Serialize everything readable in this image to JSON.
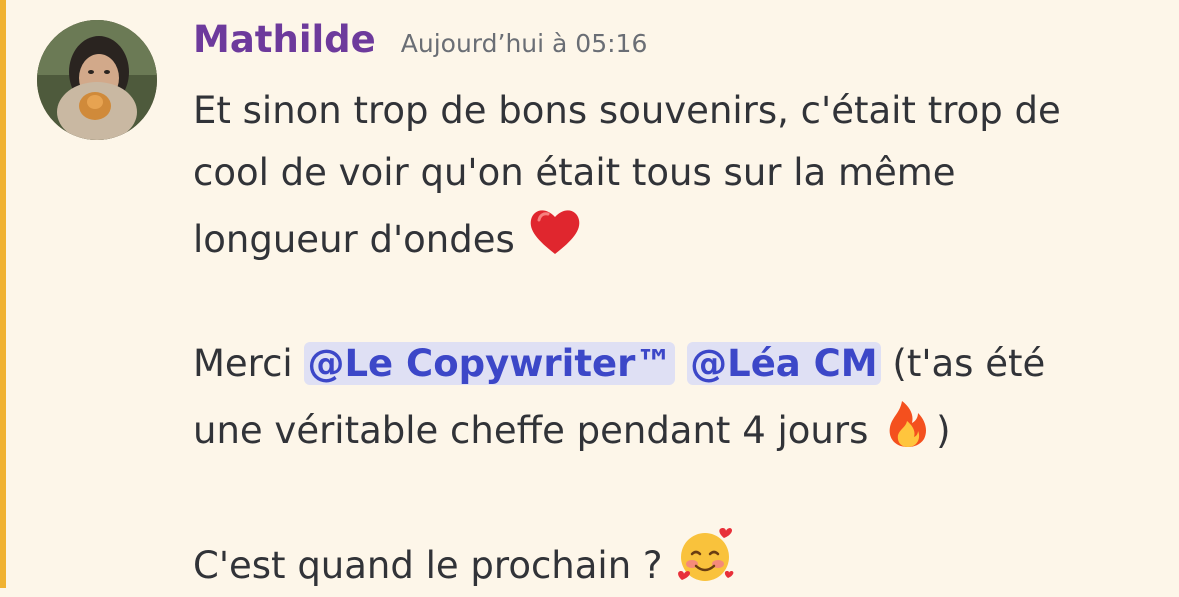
{
  "message": {
    "author": "Mathilde",
    "timestamp": "Aujourd’hui à 05:16",
    "author_color": "#6d3a9c",
    "accent_color": "#f0b232",
    "lines": {
      "l1": "Et sinon trop de bons souvenirs, c'était trop de",
      "l2": "cool de voir qu'on était tous sur la même",
      "l3": "longueur d'ondes",
      "l4_start": "Merci",
      "mention1": "@Le Copywriter™",
      "mention2": "@Léa CM",
      "l4_end": "(t'as été",
      "l5": "une véritable cheffe pendant 4 jours",
      "l5_end": ")",
      "l6": "C'est quand le prochain ?"
    },
    "emojis": [
      "red-heart-emoji",
      "fire-emoji",
      "smiling-face-with-hearts-emoji"
    ]
  }
}
